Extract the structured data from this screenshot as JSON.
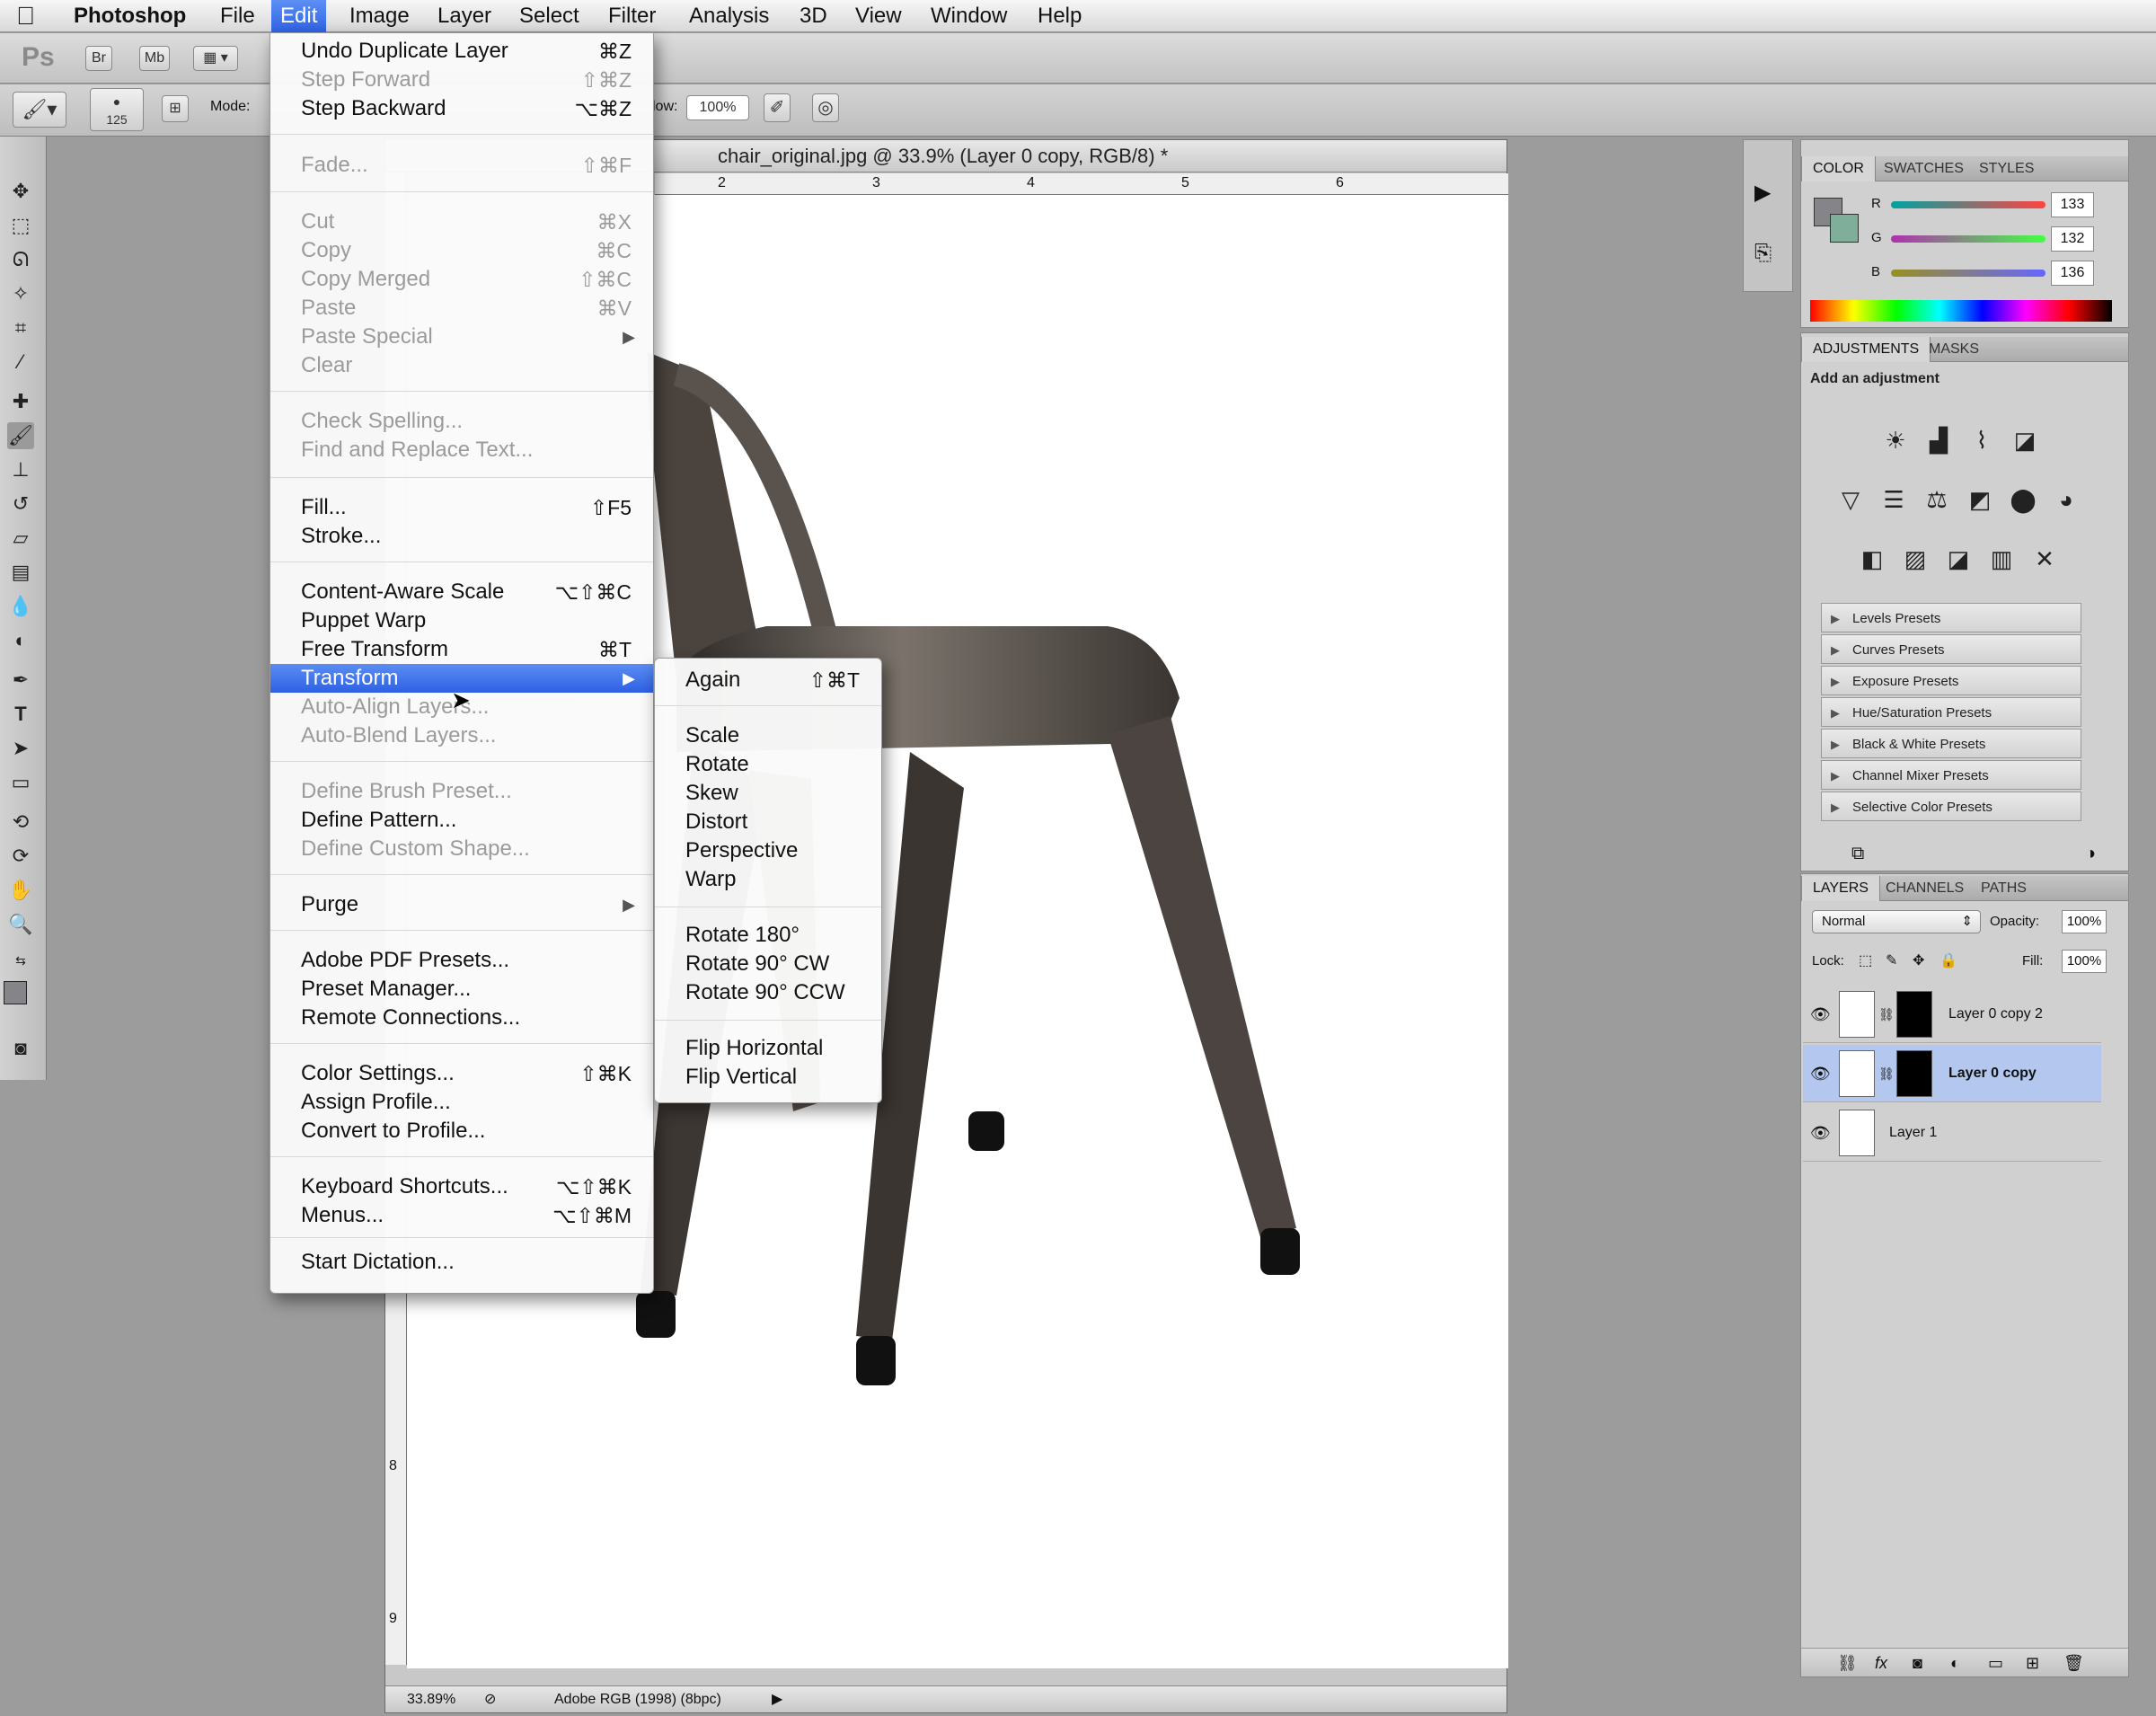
{
  "menubar": {
    "app": "Photoshop",
    "items": [
      "File",
      "Edit",
      "Image",
      "Layer",
      "Select",
      "Filter",
      "Analysis",
      "3D",
      "View",
      "Window",
      "Help"
    ]
  },
  "appbar": {
    "ps": "Ps",
    "br": "Br",
    "mb": "Mb"
  },
  "options": {
    "brush_size": "125",
    "mode_label": "Mode:",
    "flow_label": "low:",
    "flow_value": "100%"
  },
  "document": {
    "title": "chair_original.jpg @ 33.9% (Layer 0 copy, RGB/8) *",
    "zoom": "33.89%",
    "profile": "Adobe RGB (1998) (8bpc)",
    "ruler_top": [
      "2",
      "3",
      "4",
      "5",
      "6"
    ],
    "ruler_left": [
      "8",
      "9"
    ]
  },
  "edit_menu": {
    "items": [
      {
        "label": "Undo Duplicate Layer",
        "shortcut": "⌘Z"
      },
      {
        "label": "Step Forward",
        "shortcut": "⇧⌘Z"
      },
      {
        "label": "Step Backward",
        "shortcut": "⌥⌘Z"
      },
      {
        "label": "Fade...",
        "shortcut": "⇧⌘F"
      },
      {
        "label": "Cut",
        "shortcut": "⌘X"
      },
      {
        "label": "Copy",
        "shortcut": "⌘C"
      },
      {
        "label": "Copy Merged",
        "shortcut": "⇧⌘C"
      },
      {
        "label": "Paste",
        "shortcut": "⌘V"
      },
      {
        "label": "Paste Special",
        "shortcut": ""
      },
      {
        "label": "Clear",
        "shortcut": ""
      },
      {
        "label": "Check Spelling...",
        "shortcut": ""
      },
      {
        "label": "Find and Replace Text...",
        "shortcut": ""
      },
      {
        "label": "Fill...",
        "shortcut": "⇧F5"
      },
      {
        "label": "Stroke...",
        "shortcut": ""
      },
      {
        "label": "Content-Aware Scale",
        "shortcut": "⌥⇧⌘C"
      },
      {
        "label": "Puppet Warp",
        "shortcut": ""
      },
      {
        "label": "Free Transform",
        "shortcut": "⌘T"
      },
      {
        "label": "Transform",
        "shortcut": ""
      },
      {
        "label": "Auto-Align Layers...",
        "shortcut": ""
      },
      {
        "label": "Auto-Blend Layers...",
        "shortcut": ""
      },
      {
        "label": "Define Brush Preset...",
        "shortcut": ""
      },
      {
        "label": "Define Pattern...",
        "shortcut": ""
      },
      {
        "label": "Define Custom Shape...",
        "shortcut": ""
      },
      {
        "label": "Purge",
        "shortcut": ""
      },
      {
        "label": "Adobe PDF Presets...",
        "shortcut": ""
      },
      {
        "label": "Preset Manager...",
        "shortcut": ""
      },
      {
        "label": "Remote Connections...",
        "shortcut": ""
      },
      {
        "label": "Color Settings...",
        "shortcut": "⇧⌘K"
      },
      {
        "label": "Assign Profile...",
        "shortcut": ""
      },
      {
        "label": "Convert to Profile...",
        "shortcut": ""
      },
      {
        "label": "Keyboard Shortcuts...",
        "shortcut": "⌥⇧⌘K"
      },
      {
        "label": "Menus...",
        "shortcut": "⌥⇧⌘M"
      },
      {
        "label": "Start Dictation...",
        "shortcut": ""
      }
    ]
  },
  "transform_menu": {
    "items": [
      {
        "label": "Again",
        "shortcut": "⇧⌘T"
      },
      {
        "label": "Scale"
      },
      {
        "label": "Rotate"
      },
      {
        "label": "Skew"
      },
      {
        "label": "Distort"
      },
      {
        "label": "Perspective"
      },
      {
        "label": "Warp"
      },
      {
        "label": "Rotate 180°"
      },
      {
        "label": "Rotate 90° CW"
      },
      {
        "label": "Rotate 90° CCW"
      },
      {
        "label": "Flip Horizontal"
      },
      {
        "label": "Flip Vertical"
      }
    ]
  },
  "color_panel": {
    "tabs": [
      "COLOR",
      "SWATCHES",
      "STYLES"
    ],
    "r_label": "R",
    "g_label": "G",
    "b_label": "B",
    "r": "133",
    "g": "132",
    "b": "136"
  },
  "adjustments": {
    "tabs": [
      "ADJUSTMENTS",
      "MASKS"
    ],
    "hint": "Add an adjustment",
    "presets": [
      "Levels Presets",
      "Curves Presets",
      "Exposure Presets",
      "Hue/Saturation Presets",
      "Black & White Presets",
      "Channel Mixer Presets",
      "Selective Color Presets"
    ]
  },
  "layers_panel": {
    "tabs": [
      "LAYERS",
      "CHANNELS",
      "PATHS"
    ],
    "blend": "Normal",
    "opacity_label": "Opacity:",
    "opacity": "100%",
    "lock_label": "Lock:",
    "fill_label": "Fill:",
    "fill": "100%",
    "layers": [
      "Layer 0 copy 2",
      "Layer 0 copy",
      "Layer 1"
    ]
  },
  "colors": {
    "menu_highlight": "#2f63e4",
    "selected_layer": "#b4c8ef"
  }
}
